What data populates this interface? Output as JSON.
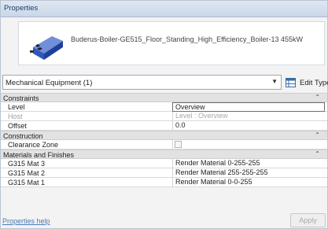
{
  "panel": {
    "title": "Properties"
  },
  "type_selector": {
    "name": "Buderus-Boiler-GE515_Floor_Standing_High_Efficiency_Boiler-13 455kW",
    "icon": "boiler-icon"
  },
  "instance_filter": {
    "value": "Mechanical Equipment (1)",
    "edit_type_label": "Edit Type"
  },
  "properties": {
    "constraints": {
      "label": "Constraints",
      "rows": [
        {
          "name": "Level",
          "value": "Overview",
          "editable": true
        },
        {
          "name": "Host",
          "value": "Level : Overview",
          "editable": false
        },
        {
          "name": "Offset",
          "value": "0.0",
          "editable": true
        }
      ]
    },
    "construction": {
      "label": "Construction",
      "rows": [
        {
          "name": "Clearance Zone",
          "value": "",
          "checked": false
        }
      ]
    },
    "materials": {
      "label": "Materials and Finishes",
      "rows": [
        {
          "name": "G315 Mat 3",
          "value": "Render Material 0-255-255"
        },
        {
          "name": "G315 Mat 2",
          "value": "Render Material 255-255-255"
        },
        {
          "name": "G315 Mat 1",
          "value": "Render Material 0-0-255"
        }
      ]
    }
  },
  "footer": {
    "help_link": "Properties help",
    "apply_label": "Apply"
  },
  "colors": {
    "header_bg": "#c9d7e8",
    "link": "#4a79b8",
    "category_bg": "#e2e2e2"
  }
}
